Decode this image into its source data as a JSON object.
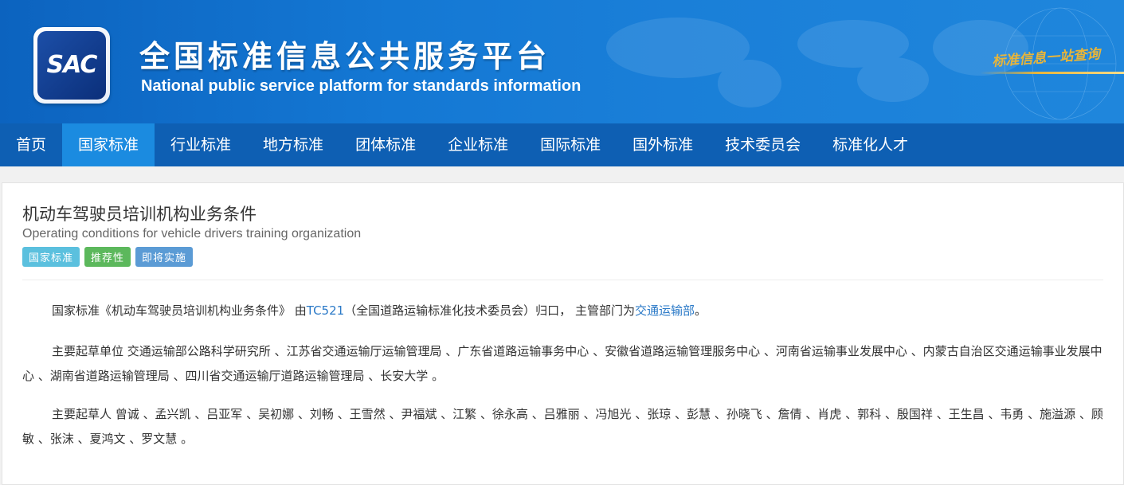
{
  "header": {
    "logo_text": "SAC",
    "title_cn": "全国标准信息公共服务平台",
    "title_en": "National public service platform  for standards information",
    "slogan": "标准信息一站查询"
  },
  "nav": {
    "items": [
      "首页",
      "国家标准",
      "行业标准",
      "地方标准",
      "团体标准",
      "企业标准",
      "国际标准",
      "国外标准",
      "技术委员会",
      "标准化人才"
    ],
    "active_index": 1
  },
  "standard": {
    "title_cn": "机动车驾驶员培训机构业务条件",
    "title_en": "Operating conditions for vehicle drivers training organization",
    "badges": [
      {
        "label": "国家标准",
        "color": "#5bc0de"
      },
      {
        "label": "推荐性",
        "color": "#5cb85c"
      },
      {
        "label": "即将实施",
        "color": "#5b9bd5"
      }
    ]
  },
  "paragraphs": {
    "p1_prefix": "国家标准《机动车驾驶员培训机构业务条件》 由",
    "p1_tc_link": "TC521",
    "p1_middle": "（全国道路运输标准化技术委员会）归口， 主管部门为",
    "p1_dept_link": "交通运输部",
    "p1_suffix": "。",
    "p2": "主要起草单位 交通运输部公路科学研究所 、江苏省交通运输厅运输管理局 、广东省道路运输事务中心 、安徽省道路运输管理服务中心 、河南省运输事业发展中心 、内蒙古自治区交通运输事业发展中心 、湖南省道路运输管理局 、四川省交通运输厅道路运输管理局 、长安大学 。",
    "p3": "主要起草人 曾诚 、孟兴凯 、吕亚军 、吴初娜 、刘畅 、王雪然 、尹福斌 、江繁 、徐永高 、吕雅丽 、冯旭光 、张琼 、彭慧 、孙晓飞 、詹倩 、肖虎 、郭科 、殷国祥 、王生昌 、韦勇 、施溢源 、顾敏 、张沫 、夏鸿文 、罗文慧 。"
  },
  "colors": {
    "header_blue": "#1478d4",
    "nav_blue": "#0e5fb3",
    "nav_active": "#1b8be0",
    "link": "#2a79c7",
    "slogan_gold": "#e8b53a"
  }
}
